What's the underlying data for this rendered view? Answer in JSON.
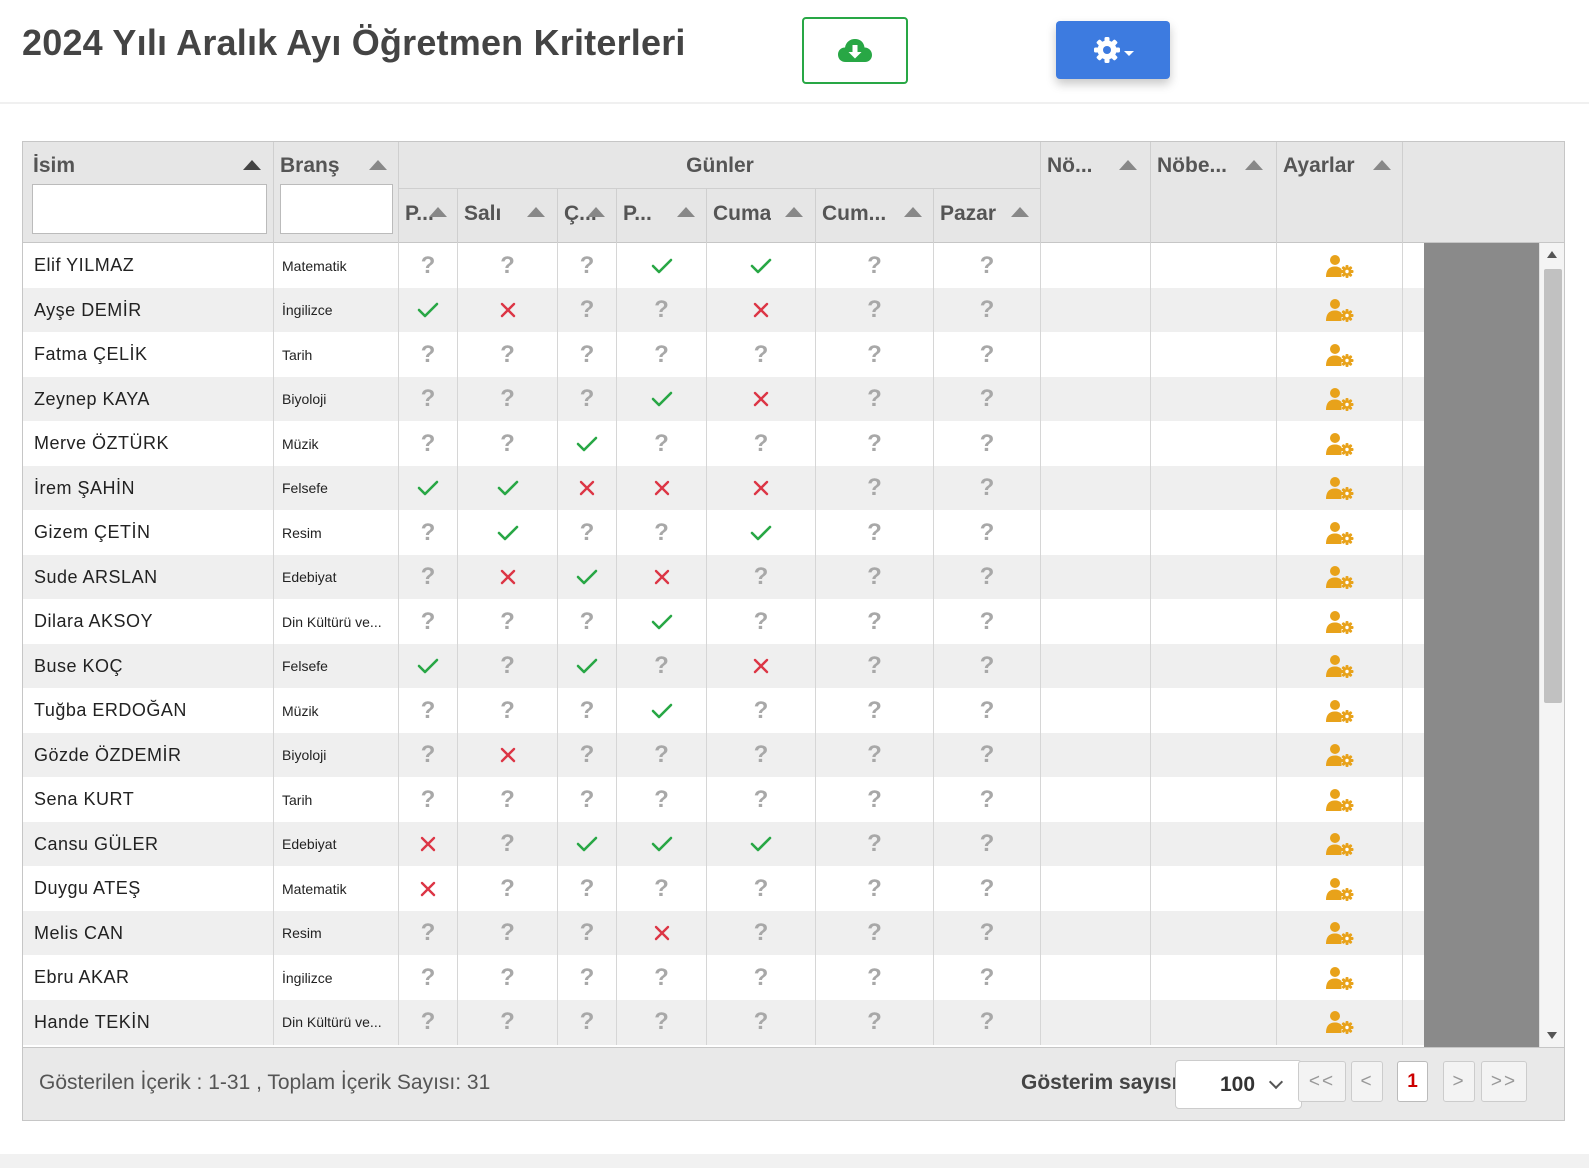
{
  "page": {
    "title": "2024 Yılı Aralık Ayı Öğretmen Kriterleri"
  },
  "toolbar": {
    "download_icon": "cloud-download-icon",
    "settings_icon": "gear-icon",
    "accent_download": "#28a745",
    "accent_settings": "#3d7be0"
  },
  "grid": {
    "columns": {
      "isim": "İsim",
      "brans": "Branş",
      "gunler": "Günler",
      "pazartesi": "P...",
      "sali": "Salı",
      "carsamba": "Ç...",
      "persembe": "P...",
      "cuma": "Cuma",
      "cumartesi": "Cum...",
      "pazar": "Pazar",
      "nobet1": "Nö...",
      "nobet2": "Nöbe...",
      "ayarlar": "Ayarlar"
    },
    "filters": {
      "isim": "",
      "brans": ""
    },
    "legend": {
      "yes": "check",
      "no": "cross",
      "unknown": "?"
    },
    "status_colors": {
      "yes": "#28a745",
      "no": "#dc3545",
      "unknown": "#a8a8a8"
    },
    "rows": [
      {
        "name": "Elif YILMAZ",
        "brans": "Matematik",
        "days": [
          "?",
          "?",
          "?",
          "y",
          "y",
          "?",
          "?"
        ],
        "nobet1": "",
        "nobet2": ""
      },
      {
        "name": "Ayşe DEMİR",
        "brans": "İngilizce",
        "days": [
          "y",
          "n",
          "?",
          "?",
          "n",
          "?",
          "?"
        ],
        "nobet1": "",
        "nobet2": ""
      },
      {
        "name": "Fatma ÇELİK",
        "brans": "Tarih",
        "days": [
          "?",
          "?",
          "?",
          "?",
          "?",
          "?",
          "?"
        ],
        "nobet1": "",
        "nobet2": ""
      },
      {
        "name": "Zeynep KAYA",
        "brans": "Biyoloji",
        "days": [
          "?",
          "?",
          "?",
          "y",
          "n",
          "?",
          "?"
        ],
        "nobet1": "",
        "nobet2": ""
      },
      {
        "name": "Merve ÖZTÜRK",
        "brans": "Müzik",
        "days": [
          "?",
          "?",
          "y",
          "?",
          "?",
          "?",
          "?"
        ],
        "nobet1": "",
        "nobet2": ""
      },
      {
        "name": "İrem ŞAHİN",
        "brans": "Felsefe",
        "days": [
          "y",
          "y",
          "n",
          "n",
          "n",
          "?",
          "?"
        ],
        "nobet1": "",
        "nobet2": ""
      },
      {
        "name": "Gizem ÇETİN",
        "brans": "Resim",
        "days": [
          "?",
          "y",
          "?",
          "?",
          "y",
          "?",
          "?"
        ],
        "nobet1": "",
        "nobet2": ""
      },
      {
        "name": "Sude ARSLAN",
        "brans": "Edebiyat",
        "days": [
          "?",
          "n",
          "y",
          "n",
          "?",
          "?",
          "?"
        ],
        "nobet1": "",
        "nobet2": ""
      },
      {
        "name": "Dilara AKSOY",
        "brans": "Din Kültürü ve...",
        "days": [
          "?",
          "?",
          "?",
          "y",
          "?",
          "?",
          "?"
        ],
        "nobet1": "",
        "nobet2": ""
      },
      {
        "name": "Buse KOÇ",
        "brans": "Felsefe",
        "days": [
          "y",
          "?",
          "y",
          "?",
          "n",
          "?",
          "?"
        ],
        "nobet1": "",
        "nobet2": ""
      },
      {
        "name": "Tuğba ERDOĞAN",
        "brans": "Müzik",
        "days": [
          "?",
          "?",
          "?",
          "y",
          "?",
          "?",
          "?"
        ],
        "nobet1": "",
        "nobet2": ""
      },
      {
        "name": "Gözde ÖZDEMİR",
        "brans": "Biyoloji",
        "days": [
          "?",
          "n",
          "?",
          "?",
          "?",
          "?",
          "?"
        ],
        "nobet1": "",
        "nobet2": ""
      },
      {
        "name": "Sena KURT",
        "brans": "Tarih",
        "days": [
          "?",
          "?",
          "?",
          "?",
          "?",
          "?",
          "?"
        ],
        "nobet1": "",
        "nobet2": ""
      },
      {
        "name": "Cansu GÜLER",
        "brans": "Edebiyat",
        "days": [
          "n",
          "?",
          "y",
          "y",
          "y",
          "?",
          "?"
        ],
        "nobet1": "",
        "nobet2": ""
      },
      {
        "name": "Duygu ATEŞ",
        "brans": "Matematik",
        "days": [
          "n",
          "?",
          "?",
          "?",
          "?",
          "?",
          "?"
        ],
        "nobet1": "",
        "nobet2": ""
      },
      {
        "name": "Melis CAN",
        "brans": "Resim",
        "days": [
          "?",
          "?",
          "?",
          "n",
          "?",
          "?",
          "?"
        ],
        "nobet1": "",
        "nobet2": ""
      },
      {
        "name": "Ebru AKAR",
        "brans": "İngilizce",
        "days": [
          "?",
          "?",
          "?",
          "?",
          "?",
          "?",
          "?"
        ],
        "nobet1": "",
        "nobet2": ""
      },
      {
        "name": "Hande TEKİN",
        "brans": "Din Kültürü ve...",
        "days": [
          "?",
          "?",
          "?",
          "?",
          "?",
          "?",
          "?"
        ],
        "nobet1": "",
        "nobet2": ""
      }
    ],
    "row_action_icon": "user-gear-icon",
    "row_action_color": "#e8a21a"
  },
  "footer": {
    "info": "Gösterilen İçerik : 1-31 , Toplam İçerik Sayısı: 31",
    "page_size_label": "Gösterim sayısı",
    "page_size_value": "100",
    "pager": {
      "first": "<<",
      "prev": "<",
      "current": "1",
      "next": ">",
      "last": ">>"
    }
  }
}
